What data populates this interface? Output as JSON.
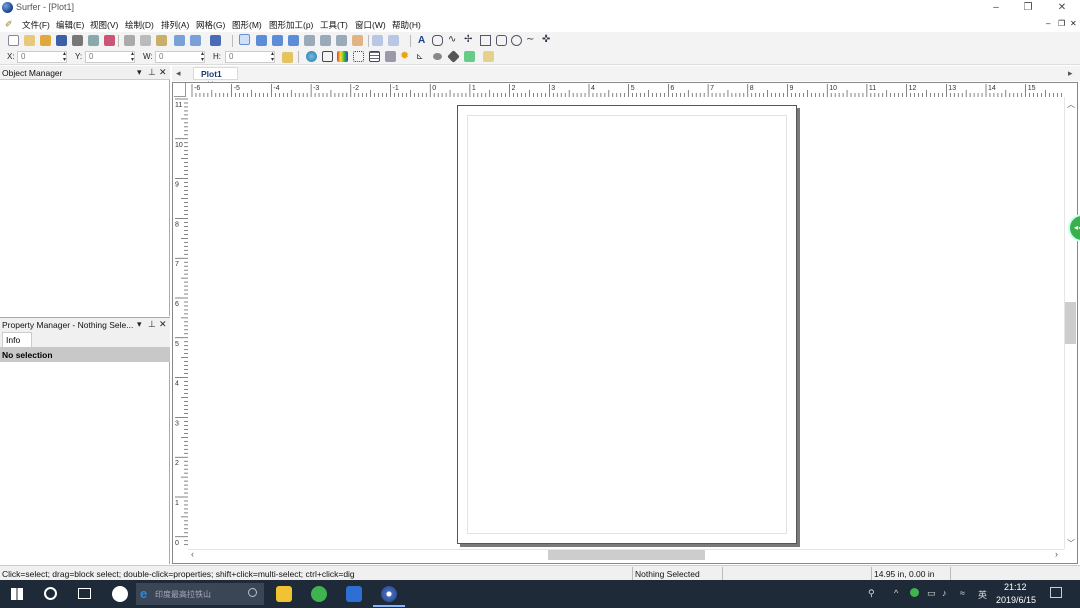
{
  "window": {
    "title": "Surfer - [Plot1]",
    "controls": {
      "minimize": "–",
      "restore": "❐",
      "close": "✕"
    }
  },
  "menu": {
    "items": [
      "文件(F)",
      "编辑(E)",
      "视图(V)",
      "绘制(D)",
      "排列(A)",
      "网格(G)",
      "图形(M)",
      "图形加工(p)",
      "工具(T)",
      "窗口(W)",
      "帮助(H)"
    ],
    "mdi": {
      "minimize": "–",
      "restore": "❐",
      "close": "✕"
    }
  },
  "coords_toolbar": {
    "x_label": "X:",
    "x_value": "0",
    "y_label": "Y:",
    "y_value": "0",
    "w_label": "W:",
    "w_value": "0",
    "h_label": "H:",
    "h_value": "0"
  },
  "object_manager": {
    "title": "Object Manager"
  },
  "property_manager": {
    "title": "Property Manager - Nothing Sele...",
    "tab": "Info",
    "no_selection": "No selection"
  },
  "doc_tabs": {
    "active": "Plot1",
    "close": "✕",
    "left_arrow": "◂",
    "right_arrow": "▸"
  },
  "ruler": {
    "top_labels": [
      "-6",
      "-5",
      "-4",
      "-3",
      "-2",
      "-1",
      "0",
      "1",
      "2",
      "3",
      "4",
      "5",
      "6",
      "7",
      "8",
      "9",
      "10",
      "11",
      "12",
      "13",
      "14",
      "15"
    ],
    "left_labels": [
      "11",
      "10",
      "9",
      "8",
      "7",
      "6",
      "5",
      "4",
      "3",
      "2",
      "1",
      "0"
    ]
  },
  "statusbar": {
    "hint": "Click=select; drag=block select; double-click=properties; shift+click=multi-select; ctrl+click=dig",
    "selection": "Nothing Selected",
    "coords": "14.95 in, 0.00 in"
  },
  "taskbar": {
    "search_placeholder": "印度最高拉铁山",
    "time": "21:12",
    "date": "2019/6/15",
    "lang": "英"
  },
  "floating_button": {
    "label": "◂◂"
  },
  "colors": {
    "accent": "#1a3b6e",
    "taskbar": "#1f2a38",
    "float": "#3ab04a"
  }
}
